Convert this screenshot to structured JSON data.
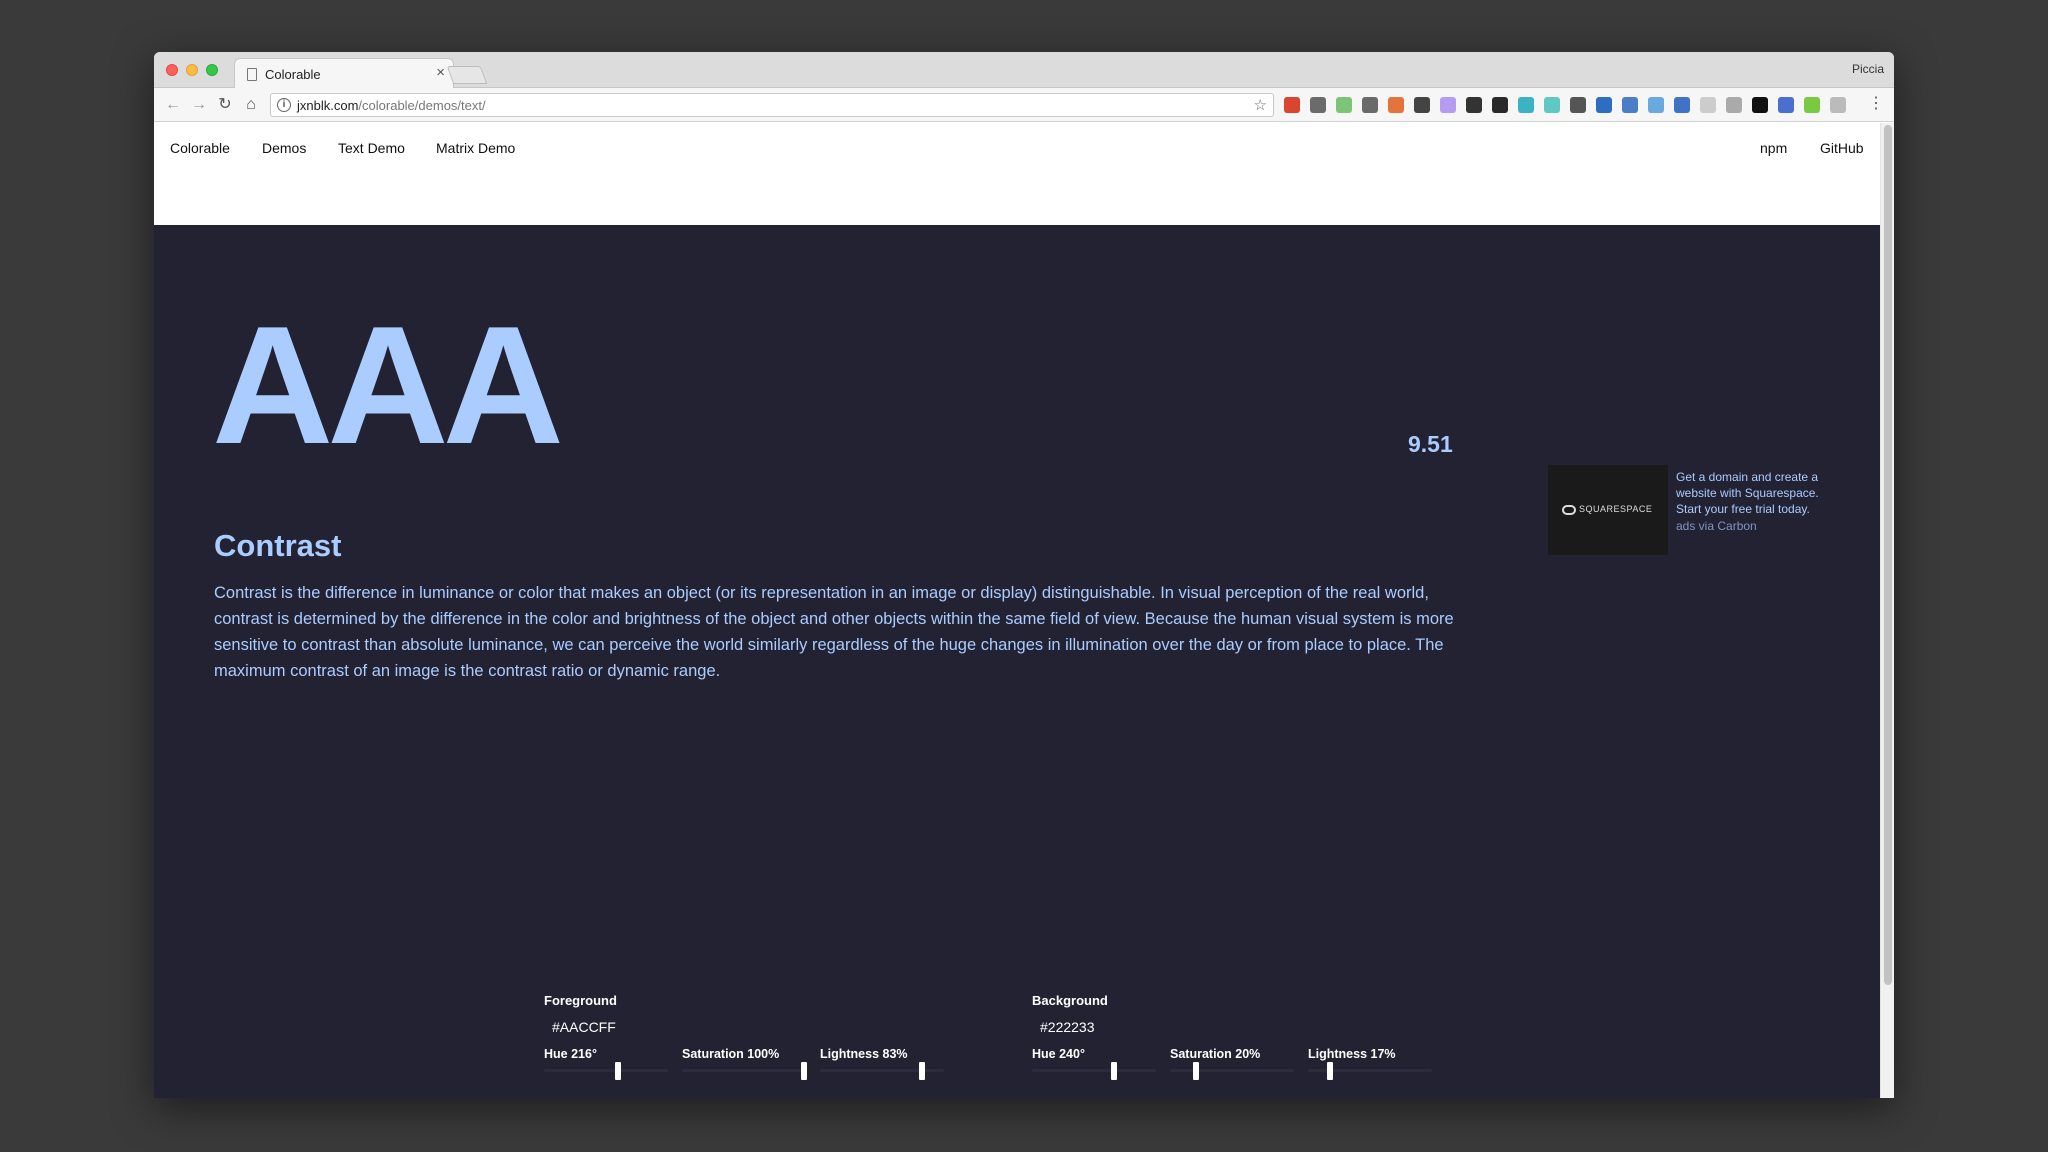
{
  "browser": {
    "tab_title": "Colorable",
    "tab_close": "×",
    "profile_name": "Piccia",
    "url_host": "jxnblk.com",
    "url_path": "/colorable/demos/text/",
    "back_glyph": "←",
    "forward_glyph": "→",
    "reload_glyph": "↻",
    "home_glyph": "⌂",
    "info_glyph": "i",
    "star_glyph": "☆",
    "menu_glyph": "⋮",
    "extensions": [
      {
        "icon": "ext-red-icon",
        "color": "#d9452e"
      },
      {
        "icon": "ext-evernote-icon",
        "color": "#6b6b6b"
      },
      {
        "icon": "ext-green-a-icon",
        "color": "#7cc576"
      },
      {
        "icon": "ext-gear-icon",
        "color": "#6a6a6a"
      },
      {
        "icon": "ext-shield-icon",
        "color": "#e5733d"
      },
      {
        "icon": "ext-dark-circle-icon",
        "color": "#444444"
      },
      {
        "icon": "ext-purple-icon",
        "color": "#b59cf0"
      },
      {
        "icon": "ext-glasses-icon",
        "color": "#333333"
      },
      {
        "icon": "ext-moon-icon",
        "color": "#2a2a2a"
      },
      {
        "icon": "ext-teal-icon",
        "color": "#3bb3c3"
      },
      {
        "icon": "ext-c-icon",
        "color": "#5fc8c0"
      },
      {
        "icon": "ext-w-icon",
        "color": "#555555"
      },
      {
        "icon": "ext-blue-square-icon",
        "color": "#2d6ec2"
      },
      {
        "icon": "ext-sync-icon",
        "color": "#4a7fc8"
      },
      {
        "icon": "ext-iq-icon",
        "color": "#6aa8e0"
      },
      {
        "icon": "ext-badge-icon",
        "color": "#3f73c8"
      },
      {
        "icon": "ext-grey-icon",
        "color": "#cccccc"
      },
      {
        "icon": "ext-code-icon",
        "color": "#aaaaaa"
      },
      {
        "icon": "ext-github-icon",
        "color": "#111111"
      },
      {
        "icon": "ext-globe-icon",
        "color": "#4a6fcf"
      },
      {
        "icon": "ext-d-icon",
        "color": "#7ac943"
      },
      {
        "icon": "ext-facebook-icon",
        "color": "#bbbbbb"
      }
    ]
  },
  "site_nav": {
    "brand": "Colorable",
    "demos": "Demos",
    "text_demo": "Text Demo",
    "matrix_demo": "Matrix Demo",
    "npm": "npm",
    "github": "GitHub"
  },
  "demo": {
    "rating": "AAA",
    "contrast_ratio": "9.51",
    "heading": "Contrast",
    "paragraph": "Contrast is the difference in luminance or color that makes an object (or its representation in an image or display) distinguishable. In visual perception of the real world, contrast is determined by the difference in the color and brightness of the object and other objects within the same field of view. Because the human visual system is more sensitive to contrast than absolute luminance, we can perceive the world similarly regardless of the huge changes in illumination over the day or from place to place. The maximum contrast of an image is the contrast ratio or dynamic range."
  },
  "ad": {
    "logo_text": "SQUARESPACE",
    "text": "Get a domain and create a website with Squarespace. Start your free trial today.",
    "via": "ads via Carbon"
  },
  "colors": {
    "foreground": "#aaccff",
    "background": "#222233"
  },
  "controls": {
    "foreground": {
      "label": "Foreground",
      "hex": "#AACCFF",
      "hue_label": "Hue 216°",
      "hue_level": 0.6,
      "saturation_label": "Saturation 100%",
      "saturation_level": 1.0,
      "lightness_label": "Lightness 83%",
      "lightness_level": 0.83
    },
    "background": {
      "label": "Background",
      "hex": "#222233",
      "hue_label": "Hue 240°",
      "hue_level": 0.667,
      "saturation_label": "Saturation 20%",
      "saturation_level": 0.2,
      "lightness_label": "Lightness 17%",
      "lightness_level": 0.17
    }
  }
}
